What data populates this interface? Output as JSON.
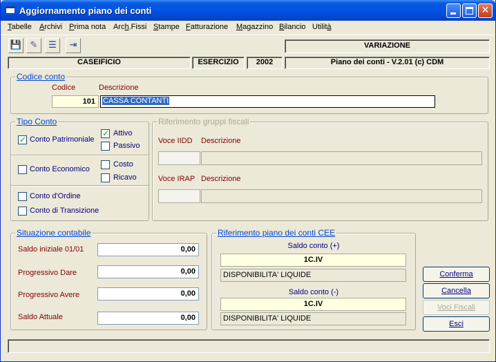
{
  "window": {
    "title": "Aggiornamento piano dei conti"
  },
  "menu": [
    {
      "label": "Tabelle",
      "u": "T"
    },
    {
      "label": "Archivi",
      "u": "A"
    },
    {
      "label": "Prima nota",
      "u": "P"
    },
    {
      "label": "Arch.Fissi",
      "u": "h"
    },
    {
      "label": "Stampe",
      "u": "S"
    },
    {
      "label": "Fatturazione",
      "u": "F"
    },
    {
      "label": "Magazzino",
      "u": "M"
    },
    {
      "label": "Bilancio",
      "u": "B"
    },
    {
      "label": "Utilità",
      "u": "à"
    }
  ],
  "header": {
    "mode": "VARIAZIONE",
    "company": "CASEIFICIO",
    "esercizio_label": "ESERCIZIO",
    "esercizio_value": "2002",
    "product": "Piano dei conti - V.2.01 (c) CDM"
  },
  "codice_conto": {
    "legend": "Codice conto",
    "codice_label": "Codice",
    "descrizione_label": "Descrizione",
    "codice_value": "101",
    "descrizione_value": "CASSA CONTANTI"
  },
  "tipo_conto": {
    "legend": "Tipo Conto",
    "patrimoniale": "Conto Patrimoniale",
    "attivo": "Attivo",
    "passivo": "Passivo",
    "economico": "Conto Economico",
    "costo": "Costo",
    "ricavo": "Ricavo",
    "ordine": "Conto d'Ordine",
    "transizione": "Conto di Transizione"
  },
  "riferimento_fiscali": {
    "legend": "Riferimento gruppi fiscali",
    "voce_iidd_label": "Voce IIDD",
    "descrizione1_label": "Descrizione",
    "voce_irap_label": "Voce IRAP",
    "descrizione2_label": "Descrizione"
  },
  "situazione": {
    "legend": "Situazione contabile",
    "rows": [
      {
        "label": "Saldo iniziale 01/01",
        "value": "0,00"
      },
      {
        "label": "Progressivo Dare",
        "value": "0,00"
      },
      {
        "label": "Progressivo Avere",
        "value": "0,00"
      },
      {
        "label": "Saldo Attuale",
        "value": "0,00"
      }
    ]
  },
  "cee": {
    "legend": "Riferimento piano dei conti CEE",
    "plus_label": "Saldo conto (+)",
    "plus_code": "1C.IV",
    "plus_desc": "DISPONIBILITA' LIQUIDE",
    "minus_label": "Saldo conto (-)",
    "minus_code": "1C.IV",
    "minus_desc": "DISPONIBILITA' LIQUIDE"
  },
  "buttons": {
    "conferma": "Conferma",
    "cancella": "Cancella",
    "voci_fiscali": "Voci Fiscali",
    "esci": "Esci"
  },
  "icons": {
    "save": "floppy-disk-icon",
    "edit": "pencil-icon",
    "list": "edit-list-icon",
    "exit": "exit-door-icon"
  }
}
